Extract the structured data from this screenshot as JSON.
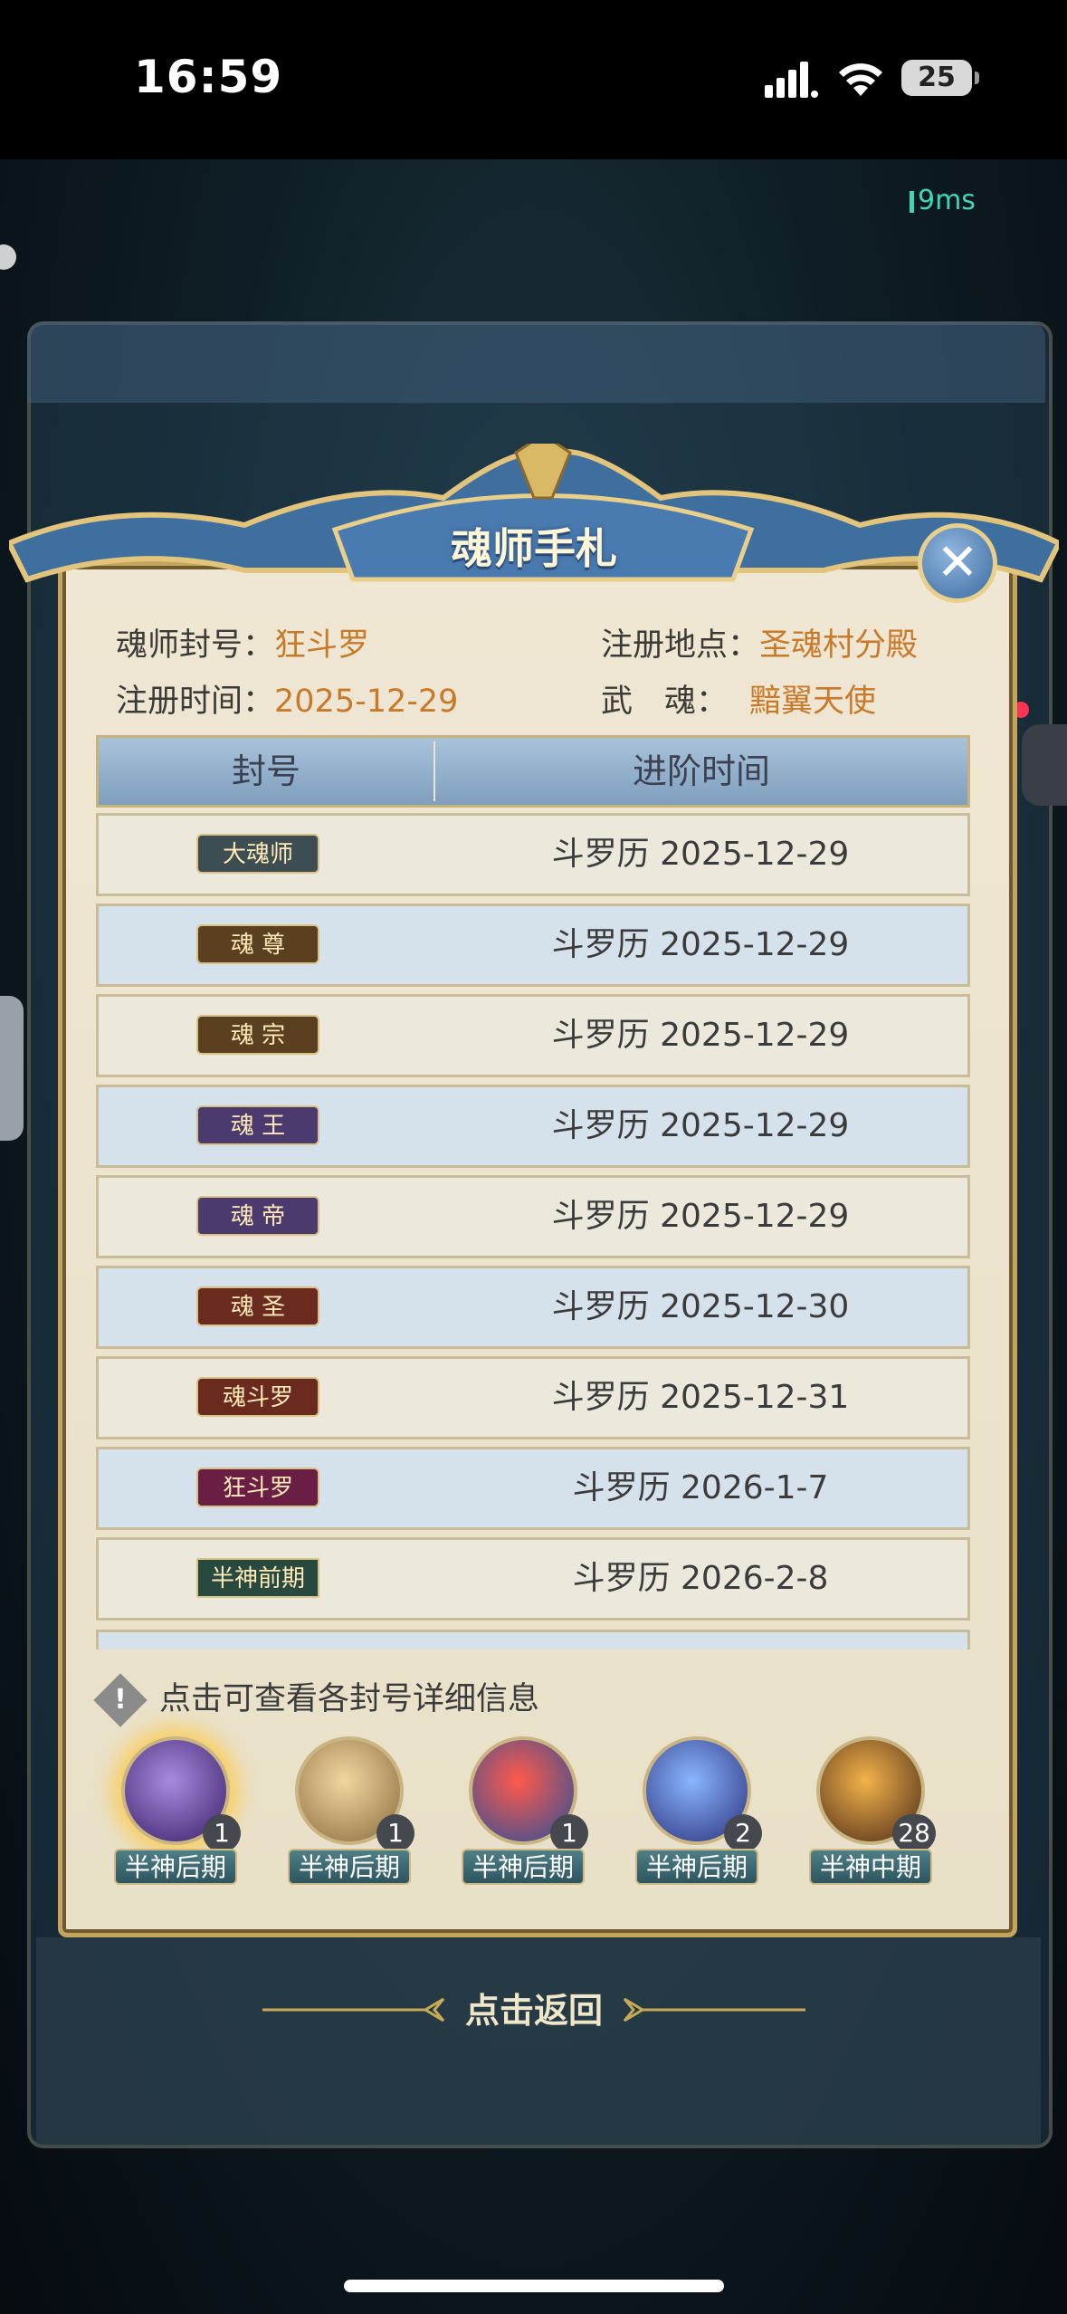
{
  "status_bar": {
    "time": "16:59",
    "battery": "25"
  },
  "game": {
    "ping": "9ms"
  },
  "modal": {
    "title": "魂师手札",
    "info": {
      "title_label": "魂师封号：",
      "title_value": "狂斗罗",
      "place_label": "注册地点：",
      "place_value": "圣魂村分殿",
      "date_label": "注册时间：",
      "date_value": "2025-12-29",
      "soul_label": "武　魂：",
      "soul_value": "黯翼天使"
    },
    "table": {
      "col_title": "封号",
      "col_time": "进阶时间",
      "rows": [
        {
          "title": "大魂师",
          "time": "斗罗历 2025-12-29",
          "color": "#3d4e52"
        },
        {
          "title": "魂 尊",
          "time": "斗罗历 2025-12-29",
          "color": "#5a4020"
        },
        {
          "title": "魂 宗",
          "time": "斗罗历 2025-12-29",
          "color": "#5a4020"
        },
        {
          "title": "魂 王",
          "time": "斗罗历 2025-12-29",
          "color": "#4b3a6e"
        },
        {
          "title": "魂 帝",
          "time": "斗罗历 2025-12-29",
          "color": "#4b3a6e"
        },
        {
          "title": "魂 圣",
          "time": "斗罗历 2025-12-30",
          "color": "#6a2a1e"
        },
        {
          "title": "魂斗罗",
          "time": "斗罗历 2025-12-31",
          "color": "#6a2a1e"
        },
        {
          "title": "狂斗罗",
          "time": "斗罗历 2026-1-7",
          "color": "#6a1e44"
        },
        {
          "title": "半神前期",
          "time": "斗罗历 2026-2-8",
          "color": "#284a3e"
        }
      ]
    },
    "hint": "点击可查看各封号详细信息",
    "souls": [
      {
        "count": "1",
        "level": "半神后期",
        "colors": [
          "#a88be0",
          "#3a1e66"
        ]
      },
      {
        "count": "1",
        "level": "半神后期",
        "colors": [
          "#f2d7a2",
          "#8a6a3c"
        ]
      },
      {
        "count": "1",
        "level": "半神后期",
        "colors": [
          "#ff5a4a",
          "#2a4f9a"
        ]
      },
      {
        "count": "2",
        "level": "半神后期",
        "colors": [
          "#8ab6ff",
          "#2a2f7a"
        ]
      },
      {
        "count": "28",
        "level": "半神中期",
        "colors": [
          "#f3b24a",
          "#4a2a18"
        ]
      }
    ]
  },
  "return_label": "点击返回"
}
